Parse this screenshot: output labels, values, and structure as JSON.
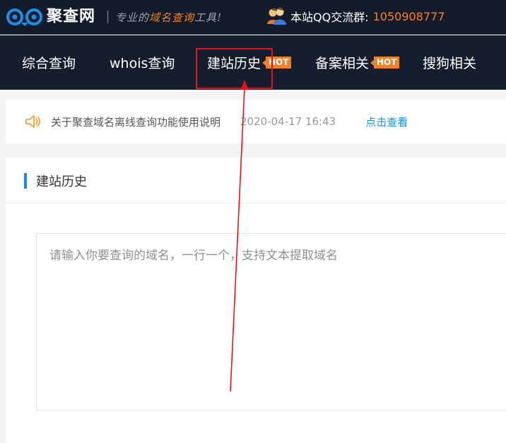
{
  "header": {
    "logo_text": "聚查网",
    "slogan_start": "专业的",
    "slogan_highlight": "域名查询",
    "slogan_end": "工具!",
    "qq_label": "本站QQ交流群:",
    "qq_number": "1050908777"
  },
  "nav": {
    "items": [
      {
        "label": "综合查询"
      },
      {
        "label": "whois查询"
      },
      {
        "label": "建站历史",
        "badge": "HOT"
      },
      {
        "label": "备案相关",
        "badge": "HOT"
      },
      {
        "label": "搜狗相关"
      }
    ]
  },
  "notice": {
    "text": "关于聚查域名离线查询功能使用说明",
    "time": "2020-04-17 16:43",
    "link_label": "点击查看"
  },
  "panel": {
    "title": "建站历史",
    "input_placeholder": "请输入你要查询的域名，一行一个，支持文本提取域名",
    "input_value": ""
  },
  "colors": {
    "header_bg": "#141c2c",
    "accent_orange": "#f0812b",
    "link_blue": "#2a8ed8",
    "title_bar_blue": "#1989e6",
    "annotation_red": "#e0161c"
  },
  "icons": {
    "logo": "owl-eyes-icon",
    "qq": "group-users-icon",
    "notice": "speaker-icon",
    "annotation": "arrow-pointer"
  }
}
